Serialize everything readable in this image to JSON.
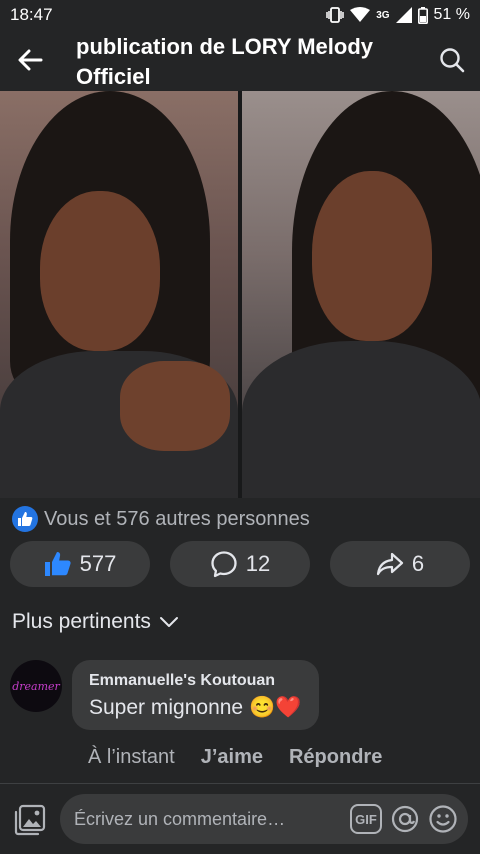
{
  "status": {
    "time": "18:47",
    "battery": "51 %",
    "network": "3G"
  },
  "header": {
    "title": "publication de LORY Melody Officiel"
  },
  "reactions": {
    "summary": "Vous et 576 autres personnes"
  },
  "actions": {
    "like_count": "577",
    "comment_count": "12",
    "share_count": "6"
  },
  "comments": {
    "sort_label": "Plus pertinents",
    "items": [
      {
        "author": "Emmanuelle's Koutouan",
        "text": "Super mignonne 😊❤️",
        "time": "À l’instant",
        "like_label": "J’aime",
        "reply_label": "Répondre",
        "avatar_text": "dreamer"
      }
    ]
  },
  "composer": {
    "placeholder": "Écrivez un commentaire…",
    "gif_label": "GIF"
  },
  "colors": {
    "background": "#242526",
    "surface": "#3a3b3c",
    "accent": "#2374e1",
    "heart": "#e41e3f"
  }
}
